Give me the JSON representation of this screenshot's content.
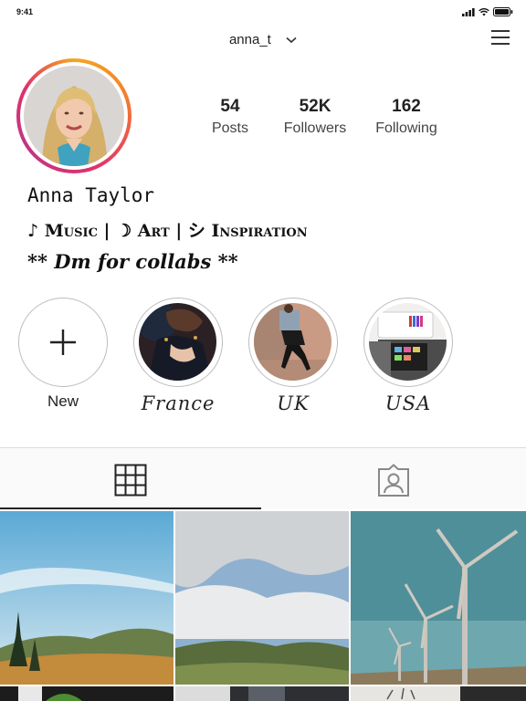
{
  "status_bar": {
    "time": "9:41"
  },
  "header": {
    "username": "anna_t"
  },
  "profile": {
    "stats": [
      {
        "value": "54",
        "label": "Posts"
      },
      {
        "value": "52K",
        "label": "Followers"
      },
      {
        "value": "162",
        "label": "Following"
      }
    ],
    "name": "Anna Taylor",
    "bio_line": "♪ Music | ☽ Art | シ Inspiration",
    "bio_cta": "** Dm for collabs **"
  },
  "highlights": [
    {
      "label": "New",
      "icon": "plus-icon"
    },
    {
      "label": "France"
    },
    {
      "label": "UK"
    },
    {
      "label": "USA"
    }
  ],
  "tabs": [
    {
      "name": "grid",
      "icon": "grid-icon",
      "active": true
    },
    {
      "name": "tagged",
      "icon": "tagged-person-icon",
      "active": false
    }
  ],
  "colors": {
    "ring_orange": "#f58529",
    "ring_pink": "#e1306c",
    "ring_purple": "#c13584"
  }
}
